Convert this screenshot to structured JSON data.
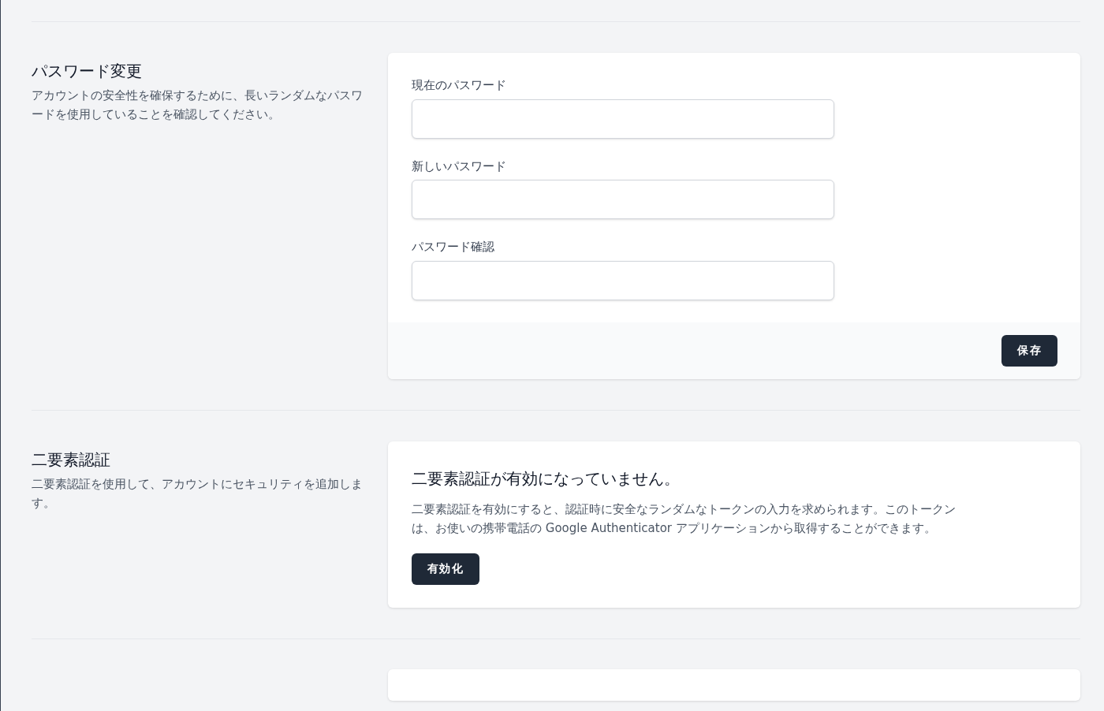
{
  "sections": [
    {
      "kind": "password",
      "title": "パスワード変更",
      "description": "アカウントの安全性を確保するために、長いランダムなパスワードを使用していることを確認してください。",
      "fields": [
        {
          "label": "現在のパスワード"
        },
        {
          "label": "新しいパスワード"
        },
        {
          "label": "パスワード確認"
        }
      ],
      "button": "保存"
    },
    {
      "kind": "twofactor",
      "title": "二要素認証",
      "description": "二要素認証を使用して、アカウントにセキュリティを追加します。",
      "heading": "二要素認証が有効になっていません。",
      "body": "二要素認証を有効にすると、認証時に安全なランダムなトークンの入力を求められます。このトークンは、お使いの携帯電話の Google Authenticator アプリケーションから取得することができます。",
      "button": "有効化"
    }
  ]
}
